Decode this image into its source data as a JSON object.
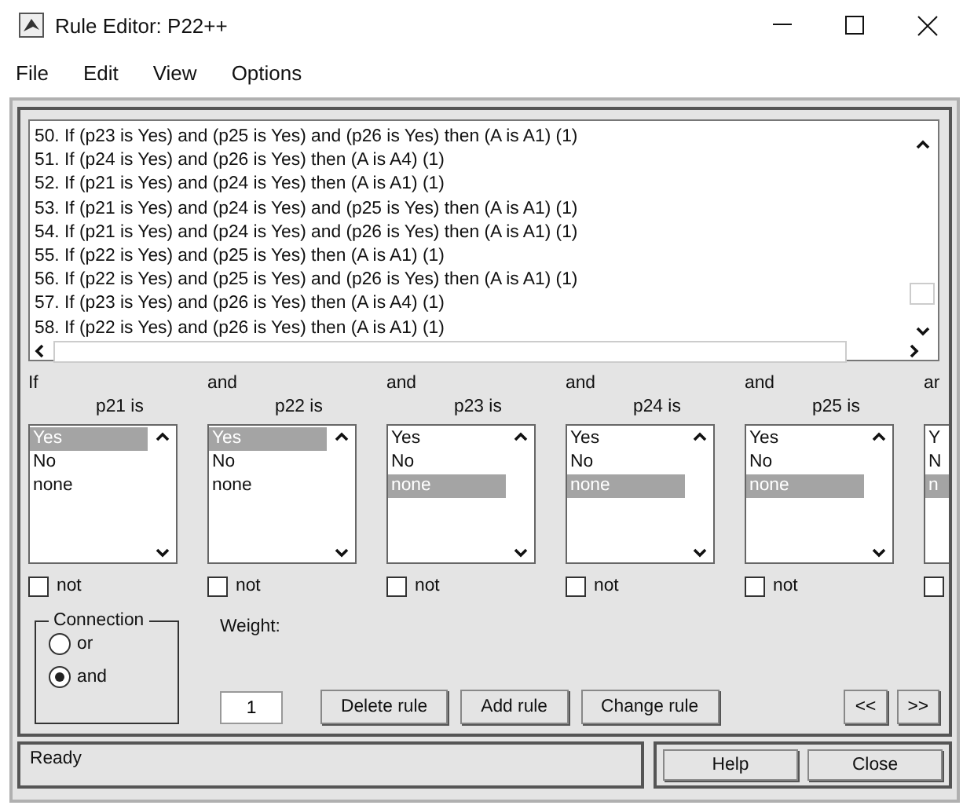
{
  "window": {
    "title": "Rule Editor: P22++"
  },
  "menu": [
    "File",
    "Edit",
    "View",
    "Options"
  ],
  "rules": [
    "50. If (p23 is Yes) and (p25 is Yes) and (p26 is Yes) then (A is A1) (1)",
    "51. If (p24 is Yes) and (p26 is Yes) then (A is A4) (1)",
    "52. If (p21 is Yes) and (p24 is Yes) then (A is A1) (1)",
    "53. If (p21 is Yes) and (p24 is Yes) and (p25 is Yes) then (A is A1) (1)",
    "54. If (p21 is Yes) and (p24 is Yes) and (p26 is Yes) then (A is A1) (1)",
    "55. If (p22 is Yes) and (p25 is Yes) then (A is A1) (1)",
    "56. If (p22 is Yes) and (p25 is Yes) and (p26 is Yes) then (A is A1) (1)",
    "57. If (p23 is Yes) and (p26 is Yes) then (A is A4) (1)",
    "58. If (p22 is Yes) and (p26 is Yes) then (A is A1) (1)"
  ],
  "antecedents": [
    {
      "connector": "If",
      "label": "p21 is",
      "options": [
        {
          "text": "Yes",
          "selected": true
        },
        {
          "text": "No",
          "selected": false
        },
        {
          "text": "none",
          "selected": false
        }
      ],
      "negated": false,
      "not_label": "not"
    },
    {
      "connector": "and",
      "label": "p22 is",
      "options": [
        {
          "text": "Yes",
          "selected": true
        },
        {
          "text": "No",
          "selected": false
        },
        {
          "text": "none",
          "selected": false
        }
      ],
      "negated": false,
      "not_label": "not"
    },
    {
      "connector": "and",
      "label": "p23 is",
      "options": [
        {
          "text": "Yes",
          "selected": false
        },
        {
          "text": "No",
          "selected": false
        },
        {
          "text": "none",
          "selected": true
        }
      ],
      "negated": false,
      "not_label": "not"
    },
    {
      "connector": "and",
      "label": "p24 is",
      "options": [
        {
          "text": "Yes",
          "selected": false
        },
        {
          "text": "No",
          "selected": false
        },
        {
          "text": "none",
          "selected": true
        }
      ],
      "negated": false,
      "not_label": "not"
    },
    {
      "connector": "and",
      "label": "p25 is",
      "options": [
        {
          "text": "Yes",
          "selected": false
        },
        {
          "text": "No",
          "selected": false
        },
        {
          "text": "none",
          "selected": true
        }
      ],
      "negated": false,
      "not_label": "not"
    },
    {
      "connector": "ar",
      "options": [
        {
          "text": "Y",
          "selected": false
        },
        {
          "text": "N",
          "selected": false
        },
        {
          "text": "n",
          "selected": true
        }
      ],
      "negated": false
    }
  ],
  "connection": {
    "title": "Connection",
    "options": [
      {
        "label": "or",
        "selected": false
      },
      {
        "label": "and",
        "selected": true
      }
    ]
  },
  "weight": {
    "label": "Weight:",
    "value": "1"
  },
  "buttons": [
    "Delete rule",
    "Add rule",
    "Change rule"
  ],
  "nav": [
    "<<",
    ">>"
  ],
  "status": "Ready",
  "footer_buttons": [
    "Help",
    "Close"
  ]
}
